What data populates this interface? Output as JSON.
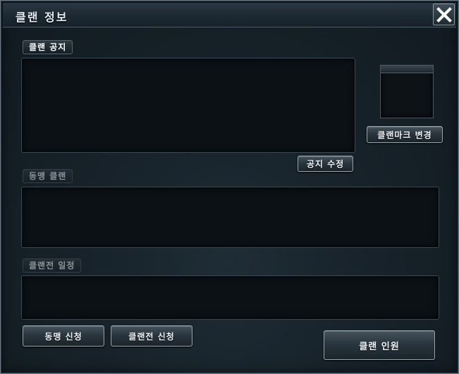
{
  "window": {
    "title": "클랜 정보",
    "close_label": "X"
  },
  "sections": {
    "notice_label": "클랜 공지",
    "alliance_label": "동맹 클랜",
    "war_schedule_label": "클랜전 일정"
  },
  "buttons": {
    "change_mark": "클랜마크 변경",
    "edit_notice": "공지 수정",
    "request_alliance": "동맹 신청",
    "request_clan_war": "클랜전 신청",
    "clan_members": "클랜 인원"
  },
  "colors": {
    "background": "#17222a",
    "panel": "#0b1115",
    "button_border": "#9aa6ae",
    "text": "#ffffff"
  }
}
